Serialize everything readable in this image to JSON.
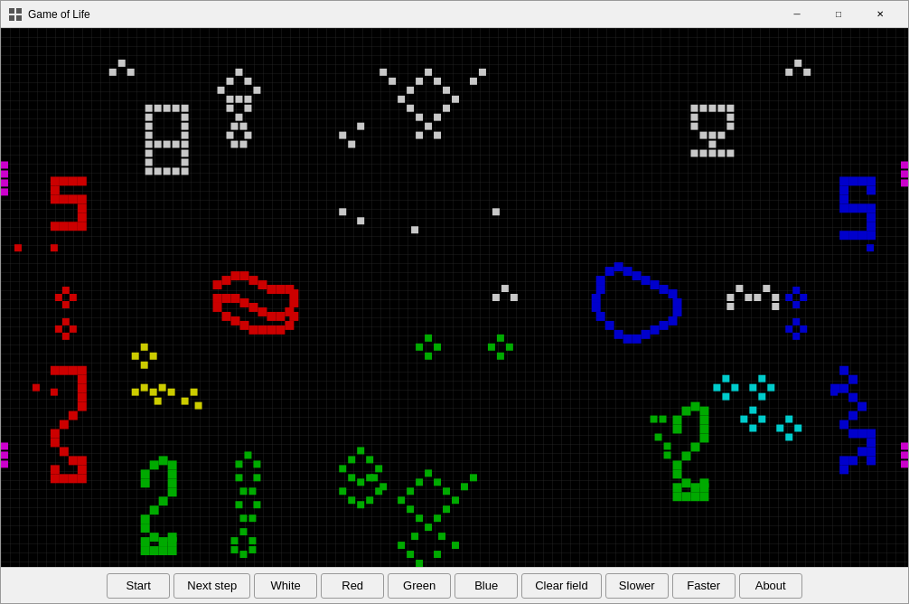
{
  "window": {
    "title": "Game of Life"
  },
  "titlebar": {
    "minimize_label": "─",
    "maximize_label": "□",
    "close_label": "✕"
  },
  "toolbar": {
    "buttons": [
      {
        "id": "start",
        "label": "Start"
      },
      {
        "id": "next-step",
        "label": "Next step"
      },
      {
        "id": "white",
        "label": "White"
      },
      {
        "id": "red",
        "label": "Red"
      },
      {
        "id": "green",
        "label": "Green"
      },
      {
        "id": "blue",
        "label": "Blue"
      },
      {
        "id": "clear-field",
        "label": "Clear field"
      },
      {
        "id": "slower",
        "label": "Slower"
      },
      {
        "id": "faster",
        "label": "Faster"
      },
      {
        "id": "about",
        "label": "About"
      }
    ]
  },
  "colors": {
    "background": "#000000",
    "white_cell": "#c8c8c8",
    "red_cell": "#cc0000",
    "green_cell": "#00aa00",
    "blue_cell": "#0000cc",
    "yellow_cell": "#cccc00",
    "cyan_cell": "#00cccc",
    "magenta_cell": "#cc00cc"
  }
}
